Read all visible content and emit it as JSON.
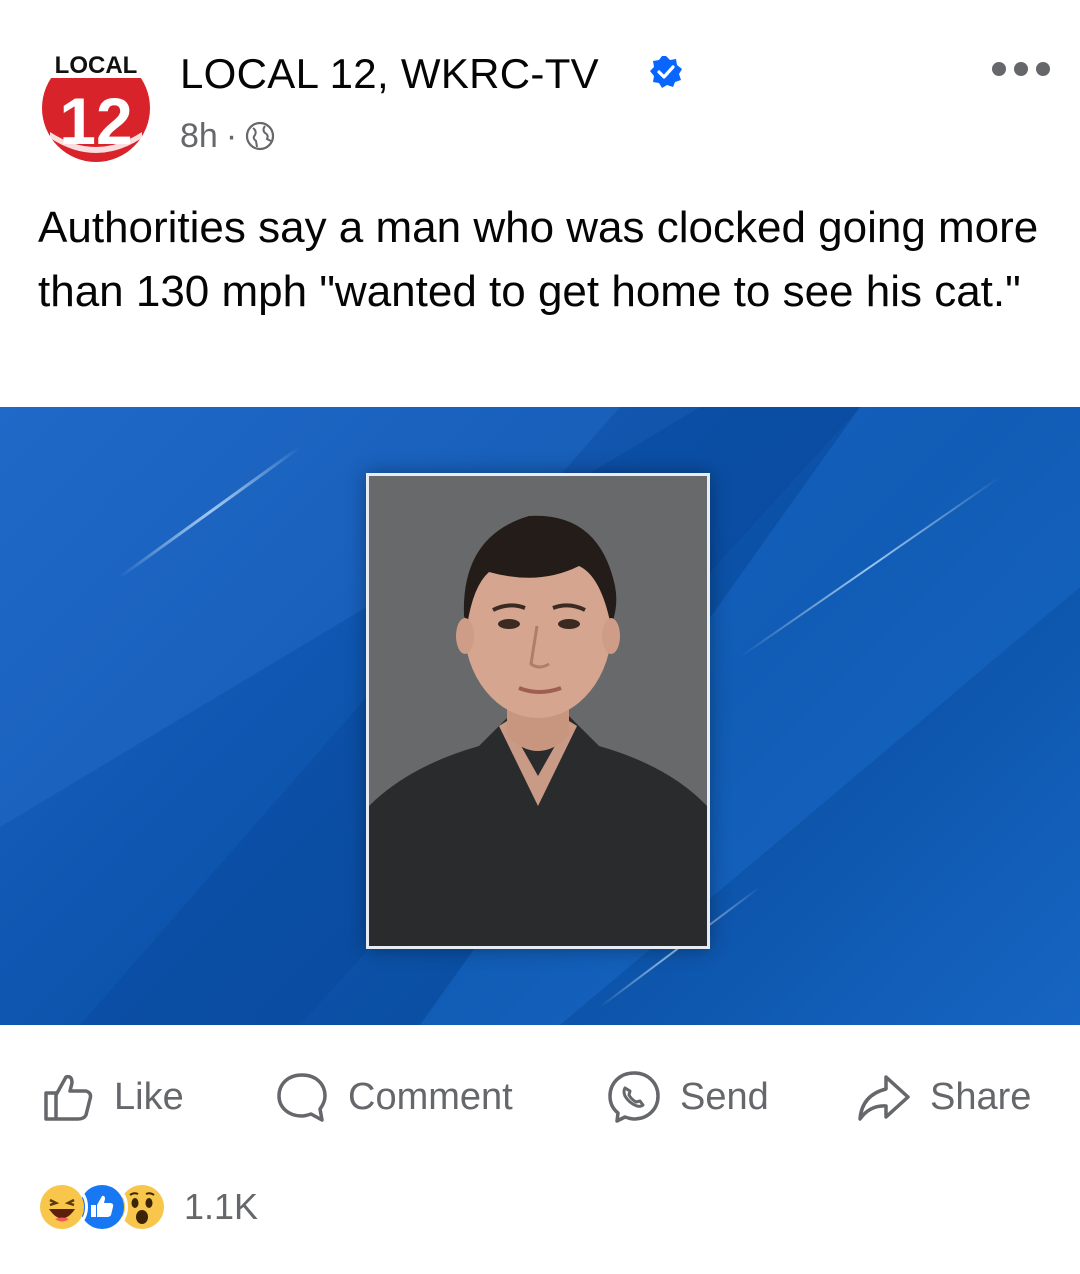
{
  "post": {
    "page_name": "LOCAL 12, WKRC-TV",
    "time": "8h",
    "separator": "·",
    "audience_icon": "globe-icon",
    "verified_icon": "verified-badge-icon",
    "more_icon": "more-options-icon",
    "avatar": {
      "logo_text": "LOCAL",
      "logo_number": "12"
    },
    "caption": "Authorities say a man who was clocked going more than 130 mph \"wanted to get home to see his cat.\""
  },
  "actions": [
    {
      "label": "Like",
      "icon": "thumbs-up-icon"
    },
    {
      "label": "Comment",
      "icon": "comment-bubble-icon"
    },
    {
      "label": "Send",
      "icon": "messenger-icon"
    },
    {
      "label": "Share",
      "icon": "share-arrow-icon"
    }
  ],
  "reactions": {
    "icons": [
      "haha-reaction-icon",
      "like-reaction-icon",
      "wow-reaction-icon"
    ],
    "count": "1.1K"
  },
  "colors": {
    "brand_blue": "#0866ff",
    "secondary_text": "#65676b",
    "media_blue": "#0e56b0",
    "logo_red": "#d8232a"
  }
}
